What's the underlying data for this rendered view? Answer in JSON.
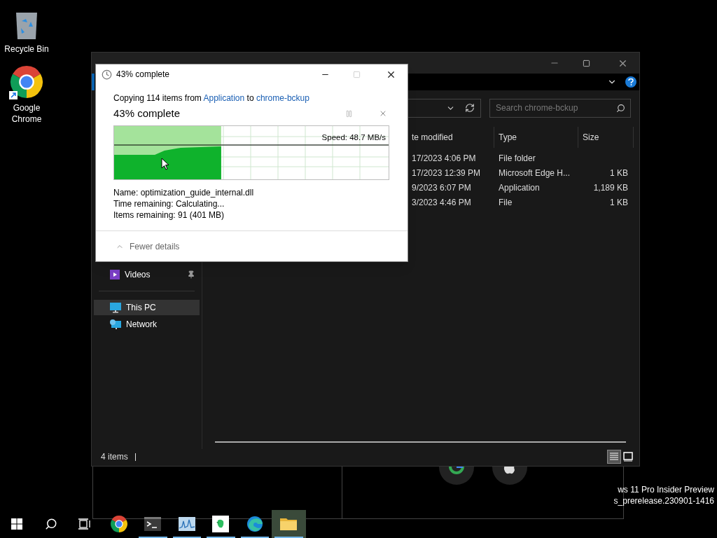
{
  "desktop_icons": [
    {
      "kind": "recycle",
      "label": "Recycle Bin"
    },
    {
      "kind": "chrome",
      "label": "Google Chrome"
    }
  ],
  "explorer": {
    "search": {
      "placeholder": "Search chrome-bckup"
    },
    "columns": [
      "te modified",
      "Type",
      "Size"
    ],
    "rows": [
      {
        "date": "17/2023 4:06 PM",
        "type": "File folder"
      },
      {
        "date": "17/2023 12:39 PM",
        "type": "Microsoft Edge H...",
        "size": "1 KB"
      },
      {
        "date": "9/2023 6:07 PM",
        "type": "Application",
        "size": "1,189 KB"
      },
      {
        "date": "3/2023 4:46 PM",
        "type": "File",
        "size": "1 KB"
      }
    ],
    "sidebar": [
      {
        "kind": "videos",
        "label": "Videos",
        "pinned": true,
        "selected": false
      },
      {
        "kind": "pc",
        "label": "This PC",
        "pinned": false,
        "selected": true
      },
      {
        "kind": "network",
        "label": "Network",
        "pinned": false,
        "selected": false
      }
    ],
    "status": "4 items",
    "view_buttons": [
      {
        "kind": "details",
        "selected": true
      },
      {
        "kind": "tiles",
        "selected": false
      }
    ]
  },
  "dialog": {
    "title": "43% complete",
    "summary": {
      "prefix": "Copying 114 items from",
      "source": "Application",
      "middle": "to",
      "destination": "chrome-bckup"
    },
    "heading": "43% complete",
    "level": 0.39,
    "speed": "Speed: 48.7 MB/s",
    "details": [
      {
        "label": "Name:",
        "value": "optimization_guide_internal.dll"
      },
      {
        "label": "Time remaining:",
        "value": "Calculating..."
      },
      {
        "label": "Items remaining:",
        "value": "91 (401 MB)"
      }
    ],
    "toggle": "Fewer details"
  },
  "watermark_lines": [
    "ws 11 Pro Insider Preview",
    "s_prerelease.230901-1416"
  ],
  "taskbar": [
    {
      "kind": "start",
      "running": false,
      "active": false
    },
    {
      "kind": "search",
      "running": false,
      "active": false
    },
    {
      "kind": "taskview",
      "running": false,
      "active": false
    },
    {
      "kind": "chrome",
      "running": false,
      "active": false
    },
    {
      "kind": "terminal",
      "running": true,
      "active": false
    },
    {
      "kind": "perfmon",
      "running": true,
      "active": false
    },
    {
      "kind": "notes",
      "running": true,
      "active": false
    },
    {
      "kind": "edge",
      "running": true,
      "active": false
    },
    {
      "kind": "folder",
      "running": true,
      "active": true
    }
  ]
}
